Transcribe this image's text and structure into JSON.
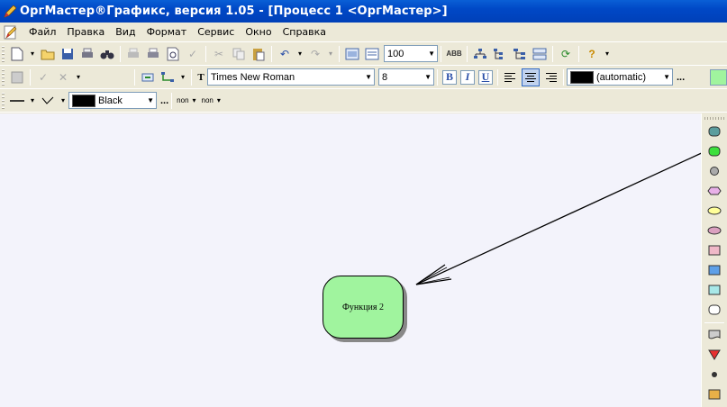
{
  "titlebar": {
    "title": "ОргМастер®Графикс, версия 1.05 - [Процесс 1 <ОргМастер>]"
  },
  "menu": {
    "items": [
      {
        "label": "Файл"
      },
      {
        "label": "Правка"
      },
      {
        "label": "Вид"
      },
      {
        "label": "Формат"
      },
      {
        "label": "Сервис"
      },
      {
        "label": "Окно"
      },
      {
        "label": "Справка"
      }
    ]
  },
  "toolbar_standard": {
    "zoom_value": "100"
  },
  "toolbar_format": {
    "font_name": "Times New Roman",
    "font_size": "8",
    "bold_label": "B",
    "italic_label": "I",
    "underline_label": "U",
    "fill_color_label": "(automatic)",
    "more_label": "..."
  },
  "toolbar_line": {
    "line_color_label": "Black",
    "more_label": "...",
    "start_cap_label": "non",
    "end_cap_label": "non"
  },
  "canvas": {
    "node_label": "Функция 2",
    "node_color": "#a0f49e"
  },
  "colors": {
    "title_blue": "#0048c6",
    "chrome": "#ece9d8",
    "canvas_bg": "#f3f3fb"
  }
}
